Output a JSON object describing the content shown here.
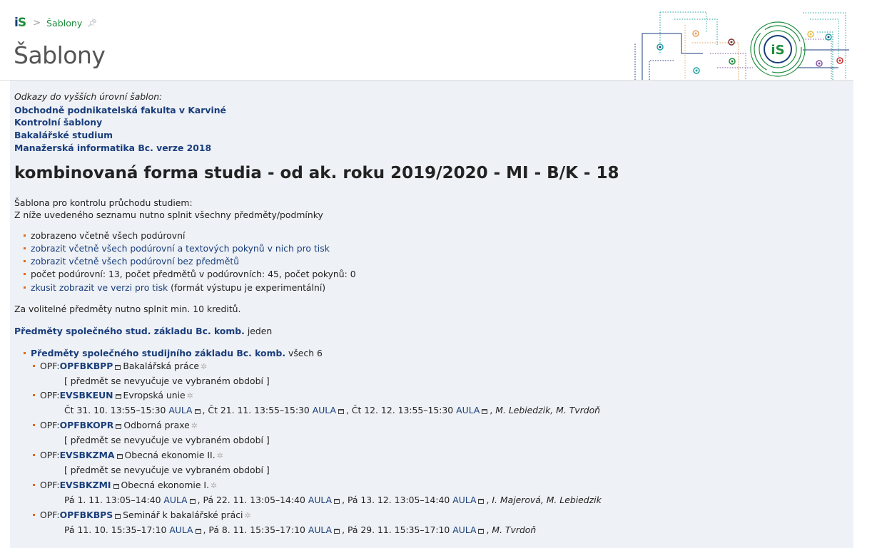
{
  "breadcrumb": {
    "logo": "iS",
    "current": "Šablony"
  },
  "page_title": "Šablony",
  "higher_levels": {
    "intro": "Odkazy do vyšších úrovní šablon:",
    "links": [
      "Obchodně podnikatelská fakulta v Karviné",
      "Kontrolní šablony",
      "Bakalářské studium",
      "Manažerská informatika Bc. verze 2018"
    ]
  },
  "heading": "kombinovaná forma studia - od ak. roku 2019/2020 - MI - B/K - 18",
  "description": {
    "line1": "Šablona pro kontrolu průchodu studiem:",
    "line2": "Z níže uvedeného seznamu nutno splnit všechny předměty/podmínky"
  },
  "options": {
    "opt1": "zobrazeno včetně všech podúrovní",
    "opt2": "zobrazit včetně všech podúrovní a textových pokynů v nich pro tisk",
    "opt3": "zobrazit včetně všech podúrovní bez předmětů",
    "opt4": "počet podúrovní: 13, počet předmětů v podúrovních: 45, počet pokynů: 0",
    "opt5_link": "zkusit zobrazit ve verzi pro tisk",
    "opt5_note": "(formát výstupu je experimentální)"
  },
  "elective_note": "Za volitelné předměty nutno splnit min. 10 kreditů.",
  "group": {
    "title": "Předměty společného stud. základu Bc. komb.",
    "suffix": "jeden"
  },
  "subgroup": {
    "title": "Předměty společného studijního základu Bc. komb.",
    "suffix": "všech 6"
  },
  "not_taught": "[ předmět se nevyučuje ve vybraném období ]",
  "room": "AULA",
  "courses": [
    {
      "prefix": "OPF:",
      "code": "OPFBKBPP",
      "name": "Bakalářská práce"
    },
    {
      "prefix": "OPF:",
      "code": "EVSBKEUN",
      "name": "Evropská unie",
      "s1": "Čt 31. 10. 13:55–15:30",
      "s2": "Čt 21. 11. 13:55–15:30",
      "s3": "Čt 12. 12. 13:55–15:30",
      "teachers": "M. Lebiedzik, M. Tvrdoň"
    },
    {
      "prefix": "OPF:",
      "code": "OPFBKOPR",
      "name": "Odborná praxe"
    },
    {
      "prefix": "OPF:",
      "code": "EVSBKZMA",
      "name": "Obecná ekonomie II."
    },
    {
      "prefix": "OPF:",
      "code": "EVSBKZMI",
      "name": "Obecná ekonomie I.",
      "s1": "Pá 1. 11. 13:05–14:40",
      "s2": "Pá 22. 11. 13:05–14:40",
      "s3": "Pá 13. 12. 13:05–14:40",
      "teachers": "I. Majerová, M. Lebiedzik"
    },
    {
      "prefix": "OPF:",
      "code": "OPFBKBPS",
      "name": "Seminář k bakalářské práci",
      "s1": "Pá 11. 10. 15:35–17:10",
      "s2": "Pá 8. 11. 15:35–17:10",
      "s3": "Pá 29. 11. 15:35–17:10",
      "teachers": "M. Tvrdoň"
    }
  ],
  "colors": {
    "link": "#1a3e7c",
    "brand_green": "#1e8c3c",
    "bullet": "#e06a1a",
    "content_bg": "#eef1f5"
  },
  "icons": {
    "breadcrumb_sep": "chevron-right-icon",
    "pin": "pin-icon",
    "room": "room-icon",
    "gear": "gear-icon"
  }
}
